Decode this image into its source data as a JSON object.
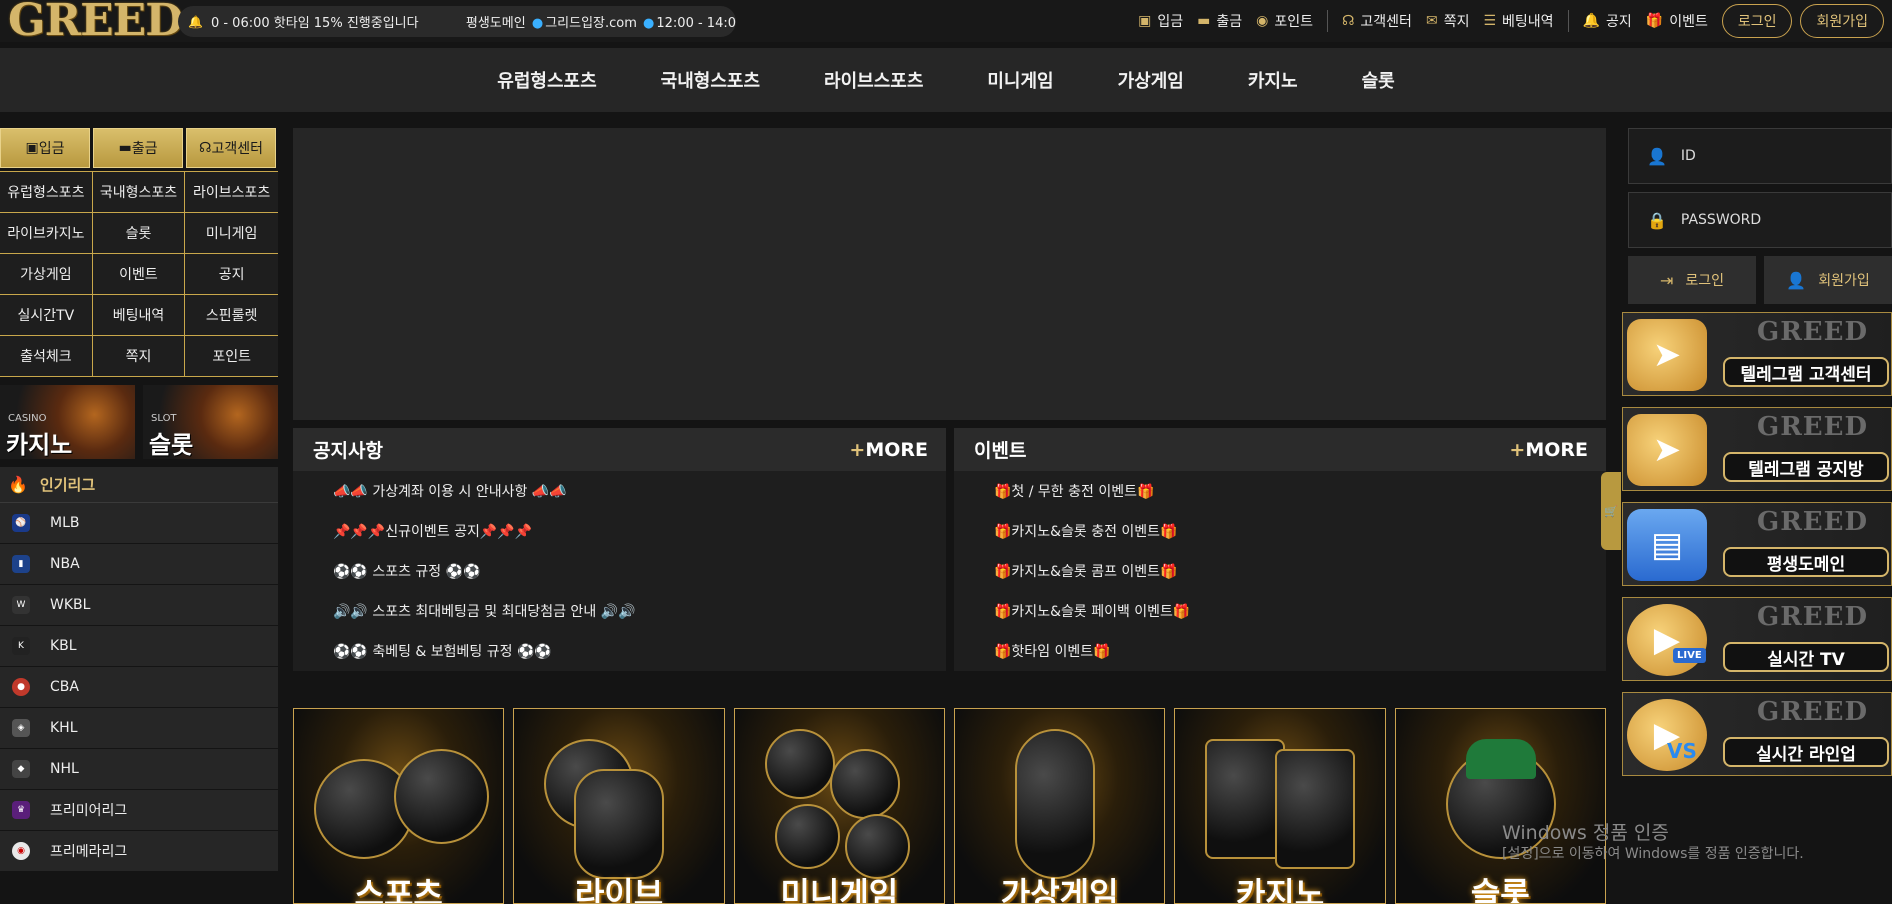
{
  "header": {
    "logo": "GREED",
    "ticker_1": "0 - 06:00 핫타임 15% 진행중입니다",
    "ticker_2a": "평생도메인",
    "ticker_2b": "그리드입장.com",
    "ticker_2c": "12:00 - 14:0",
    "links": [
      "입금",
      "출금",
      "포인트",
      "고객센터",
      "쪽지",
      "베팅내역",
      "공지",
      "이벤트"
    ],
    "login_button": "로그인",
    "signup_button": "회원가입"
  },
  "main_nav": [
    "유럽형스포츠",
    "국내형스포츠",
    "라이브스포츠",
    "미니게임",
    "가상게임",
    "카지노",
    "슬롯"
  ],
  "left": {
    "quick": [
      "입금",
      "출금",
      "고객센터"
    ],
    "grid": [
      "유럽형스포츠",
      "국내형스포츠",
      "라이브스포츠",
      "라이브카지노",
      "슬롯",
      "미니게임",
      "가상게임",
      "이벤트",
      "공지",
      "실시간TV",
      "베팅내역",
      "스핀룰렛",
      "출석체크",
      "쪽지",
      "포인트"
    ],
    "banner_casino_en": "CASINO",
    "banner_casino": "카지노",
    "banner_slot_en": "SLOT",
    "banner_slot": "슬롯",
    "popular_title": "인기리그",
    "leagues": [
      "MLB",
      "NBA",
      "WKBL",
      "KBL",
      "CBA",
      "KHL",
      "NHL",
      "프리미어리그",
      "프리메라리그"
    ]
  },
  "notice": {
    "title": "공지사항",
    "more_plus": "+",
    "more": "MORE",
    "items": [
      "📣📣 가상계좌 이용 시 안내사항 📣📣",
      "📌📌📌신규이벤트 공지📌📌📌",
      "⚽⚽ 스포츠 규정 ⚽⚽",
      "🔊🔊 스포츠 최대베팅금 및 최대당첨금 안내 🔊🔊",
      "⚽⚽ 축베팅 & 보험베팅 규정 ⚽⚽"
    ]
  },
  "event": {
    "title": "이벤트",
    "more_plus": "+",
    "more": "MORE",
    "items": [
      "🎁첫 / 무한 충전 이벤트🎁",
      "🎁카지노&슬롯 충전 이벤트🎁",
      "🎁카지노&슬롯 콤프 이벤트🎁",
      "🎁카지노&슬롯 페이백 이벤트🎁",
      "🎁핫타임 이벤트🎁"
    ]
  },
  "game_cards": [
    "스포츠",
    "라이브",
    "미니게임",
    "가상게임",
    "카지노",
    "슬롯"
  ],
  "right": {
    "id_placeholder": "ID",
    "pw_placeholder": "PASSWORD",
    "login": "로그인",
    "signup": "회원가입",
    "banner_brand": "GREED",
    "banners": [
      "텔레그램 고객센터",
      "텔레그램 공지방",
      "평생도메인",
      "실시간 TV",
      "실시간 라인업"
    ],
    "live_tag": "LIVE",
    "vs_tag": "VS"
  },
  "watermark": {
    "line1": "Windows 정품 인증",
    "line2": "[설정]으로 이동하여 Windows를 정품 인증합니다."
  },
  "colors": {
    "gold": "#d4b56a",
    "background": "#141414",
    "panel": "#262626"
  }
}
